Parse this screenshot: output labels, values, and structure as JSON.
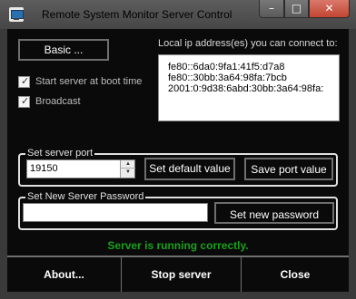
{
  "window": {
    "title": "Remote System Monitor Server Control",
    "controls": {
      "minimize": "–",
      "maximize": "□",
      "close": "✕"
    }
  },
  "basic_button": "Basic ...",
  "ip": {
    "label": "Local ip address(es) you can connect to:",
    "addresses": [
      "fe80::6da0:9fa1:41f5:d7a8",
      "fe80::30bb:3a64:98fa:7bcb",
      "2001:0:9d38:6abd:30bb:3a64:98fa:"
    ]
  },
  "options": {
    "start_at_boot": {
      "label": "Start server at boot time",
      "checked": true
    },
    "broadcast": {
      "label": "Broadcast",
      "checked": true
    }
  },
  "port": {
    "legend": "Set server port",
    "value": "19150",
    "default_button": "Set default value",
    "save_button": "Save port value"
  },
  "password": {
    "legend": "Set New Server Password",
    "value": "",
    "set_button": "Set new password"
  },
  "status": {
    "text": "Server is running correctly.",
    "color": "#19a11a"
  },
  "bottom": {
    "about": "About...",
    "stop": "Stop server",
    "close": "Close"
  },
  "icons": {
    "app": "monitor-icon",
    "checkmark": "✓",
    "step_up": "▲",
    "step_down": "▼"
  }
}
